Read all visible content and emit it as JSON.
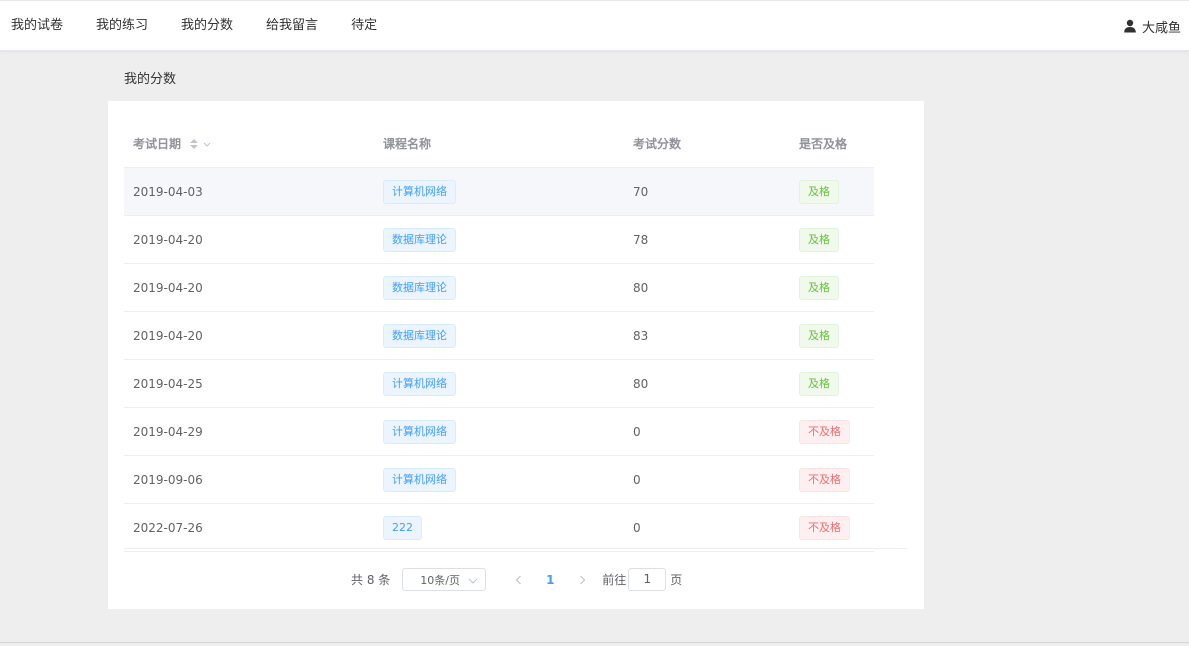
{
  "nav": {
    "items": [
      {
        "label": "我的试卷"
      },
      {
        "label": "我的练习"
      },
      {
        "label": "我的分数"
      },
      {
        "label": "给我留言"
      },
      {
        "label": "待定"
      }
    ],
    "user_name": "大咸鱼",
    "user_icon": "user-icon"
  },
  "page_title": "我的分数",
  "table": {
    "headers": [
      "考试日期",
      "课程名称",
      "考试分数",
      "是否及格"
    ],
    "rows": [
      {
        "date": "2019-04-03",
        "course": "计算机网络",
        "score": "70",
        "status": "及格"
      },
      {
        "date": "2019-04-20",
        "course": "数据库理论",
        "score": "78",
        "status": "及格"
      },
      {
        "date": "2019-04-20",
        "course": "数据库理论",
        "score": "80",
        "status": "及格"
      },
      {
        "date": "2019-04-20",
        "course": "数据库理论",
        "score": "83",
        "status": "及格"
      },
      {
        "date": "2019-04-25",
        "course": "计算机网络",
        "score": "80",
        "status": "及格"
      },
      {
        "date": "2019-04-29",
        "course": "计算机网络",
        "score": "0",
        "status": "不及格"
      },
      {
        "date": "2019-09-06",
        "course": "计算机网络",
        "score": "0",
        "status": "不及格"
      },
      {
        "date": "2022-07-26",
        "course": "222",
        "score": "0",
        "status": "不及格"
      }
    ]
  },
  "pagination": {
    "total_text": "共 8 条",
    "page_size": "10条/页",
    "current_page": "1",
    "goto_prefix": "前往",
    "goto_value": "1",
    "goto_suffix": "页"
  },
  "colors": {
    "accent": "#409eff",
    "pass": "#67c23a",
    "fail": "#f56c6c"
  }
}
